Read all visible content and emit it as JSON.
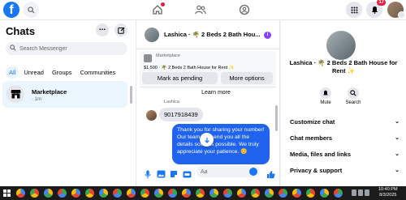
{
  "topbar": {
    "logo": "f",
    "notification_count": "17"
  },
  "sidebar": {
    "title": "Chats",
    "more_label": "...",
    "search_placeholder": "Search Messenger",
    "tabs": [
      {
        "label": "All"
      },
      {
        "label": "Unread"
      },
      {
        "label": "Groups"
      },
      {
        "label": "Communities"
      }
    ],
    "chats": [
      {
        "name": "Marketplace",
        "time": "· 1m"
      }
    ]
  },
  "conversation": {
    "header_name": "Lashica · 🌴 2 Beds 2 Bath Hou...",
    "info_label": "i",
    "listing": {
      "label": "Marketplace",
      "title": "$1,500 · 🌴 2 Beds 2 Bath House for Rent ✨",
      "pending_button": "Mark as pending",
      "options_button": "More options"
    },
    "ghost_button": "Learn more",
    "sender_label": "Lashica",
    "incoming_message": "9017918439",
    "outgoing_message": "Thank you for sharing your number! Our team will send you all the details soon as possible. We truly appreciate your patience. 😊",
    "composer_placeholder": "Aa"
  },
  "details": {
    "name": "Lashica · 🌴 2 Beds 2 Bath House for Rent ✨",
    "actions": [
      {
        "label": "Mute"
      },
      {
        "label": "Search"
      }
    ],
    "sections": [
      {
        "label": "Customize chat"
      },
      {
        "label": "Chat members"
      },
      {
        "label": "Media, files and links"
      },
      {
        "label": "Privacy & support"
      }
    ]
  },
  "taskbar": {
    "time": "10:40 PM",
    "date": "8/3/2025"
  },
  "colors": {
    "brand_blue": "#1877f2",
    "message_blue": "#1f63ef",
    "notification_red": "#e41e3f",
    "info_purple": "#8a3ffc"
  },
  "icons": [
    "facebook-logo-icon",
    "search-icon",
    "home-icon",
    "friends-icon",
    "groups-icon",
    "menu-grid-icon",
    "bell-icon",
    "marketplace-store-icon",
    "compose-icon",
    "chevron-down-icon",
    "mic-icon",
    "image-icon",
    "sticker-icon",
    "gif-icon",
    "emoji-icon",
    "thumbs-up-icon",
    "mute-bell-icon",
    "arrow-down-icon"
  ]
}
